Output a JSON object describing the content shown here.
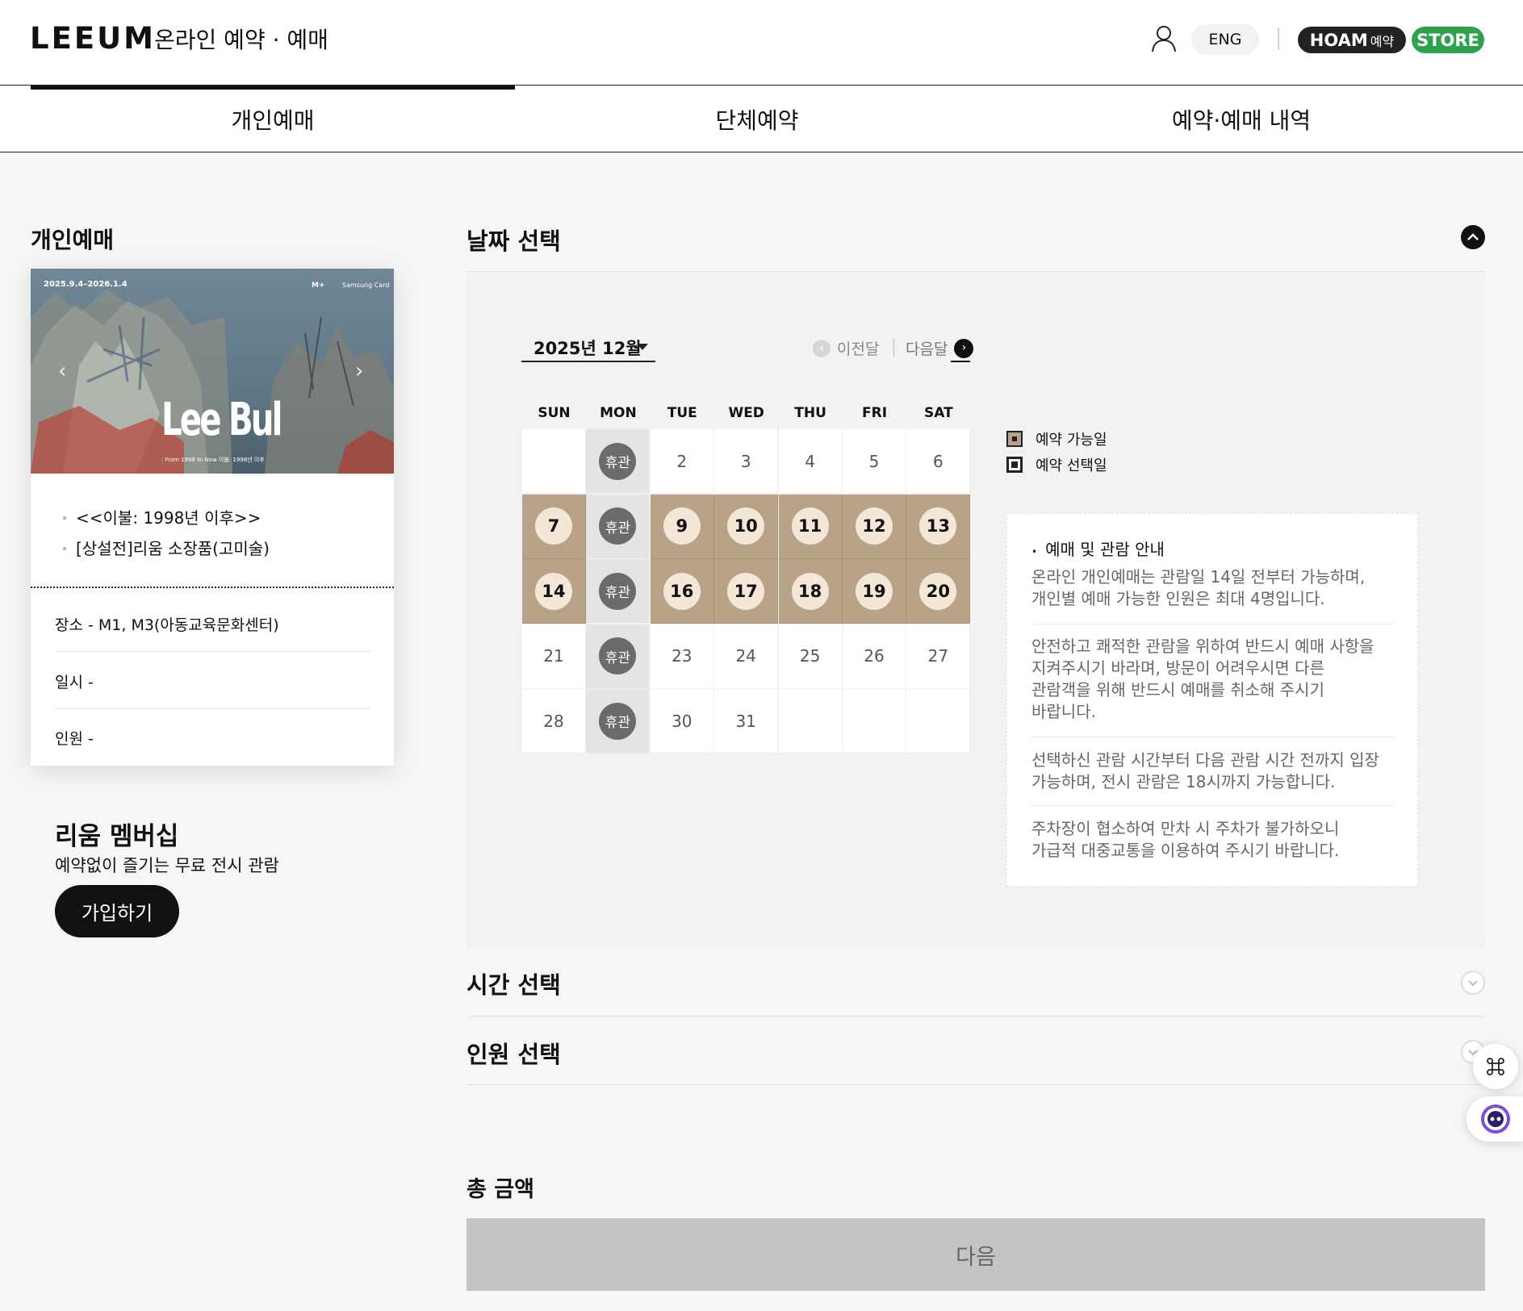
{
  "header": {
    "logo": "LEEUM",
    "title": "온라인 예약 · 예매",
    "lang_button": "ENG",
    "hoam_label": "HOAM",
    "hoam_sub": "예약",
    "store_label": "STORE"
  },
  "tabs": [
    {
      "label": "개인예매",
      "active": true
    },
    {
      "label": "단체예약",
      "active": false
    },
    {
      "label": "예약·예매 내역",
      "active": false
    }
  ],
  "left": {
    "title": "개인예매",
    "poster": {
      "date": "2025.9.4–2026.1.4",
      "mplus": "M+",
      "sponsor": "Samsung Card",
      "artist": "Lee Bul",
      "subtitle": ": From 1998 to Now    이불: 1998년 이후"
    },
    "exhibitions": [
      "<<이불: 1998년 이후>>",
      "[상설전]리움 소장품(고미술)"
    ],
    "place": "장소 - M1, M3(아동교육문화센터)",
    "datetime": "일시 -",
    "people": "인원 -",
    "membership_title": "리움 멤버십",
    "membership_desc": "예약없이 즐기는 무료 전시 관람",
    "join_button": "가입하기"
  },
  "date_section": {
    "title": "날짜 선택",
    "month_label": "2025년 12월",
    "prev_label": "이전달",
    "next_label": "다음달",
    "weekdays": [
      "SUN",
      "MON",
      "TUE",
      "WED",
      "THU",
      "FRI",
      "SAT"
    ],
    "closed_label": "휴관",
    "weeks": [
      [
        "",
        "휴관",
        "2",
        "3",
        "4",
        "5",
        "6"
      ],
      [
        "7",
        "휴관",
        "9",
        "10",
        "11",
        "12",
        "13"
      ],
      [
        "14",
        "휴관",
        "16",
        "17",
        "18",
        "19",
        "20"
      ],
      [
        "21",
        "휴관",
        "23",
        "24",
        "25",
        "26",
        "27"
      ],
      [
        "28",
        "휴관",
        "30",
        "31",
        "",
        "",
        ""
      ]
    ],
    "available_days": [
      "7",
      "9",
      "10",
      "11",
      "12",
      "13",
      "14",
      "16",
      "17",
      "18",
      "19",
      "20"
    ],
    "legend_available": "예약 가능일",
    "legend_selected": "예약 선택일",
    "colors": {
      "available_bg": "#b9a388",
      "available_circle": "#f4e7d8",
      "closed_circle": "#6b6b6b"
    }
  },
  "notice": {
    "heading": "예매 및 관람 안내",
    "items": [
      [
        "온라인 개인예매는 관람일 14일 전부터 가능하며,",
        "개인별 예매 가능한 인원은 최대 4명입니다."
      ],
      [
        "안전하고 쾌적한 관람을 위하여 반드시 예매 사항을",
        "지켜주시기 바라며, 방문이 어려우시면 다른",
        "관람객을 위해 반드시 예매를 취소해 주시기",
        "바랍니다."
      ],
      [
        "선택하신 관람 시간부터 다음 관람 시간 전까지 입장",
        "가능하며, 전시 관람은 18시까지 가능합니다."
      ],
      [
        "주차장이 협소하여 만차 시 주차가 불가하오니",
        "가급적 대중교통을 이용하여 주시기 바랍니다."
      ]
    ]
  },
  "time_section": {
    "title": "시간 선택"
  },
  "people_section": {
    "title": "인원 선택"
  },
  "total": {
    "label": "총 금액"
  },
  "next_button": "다음"
}
